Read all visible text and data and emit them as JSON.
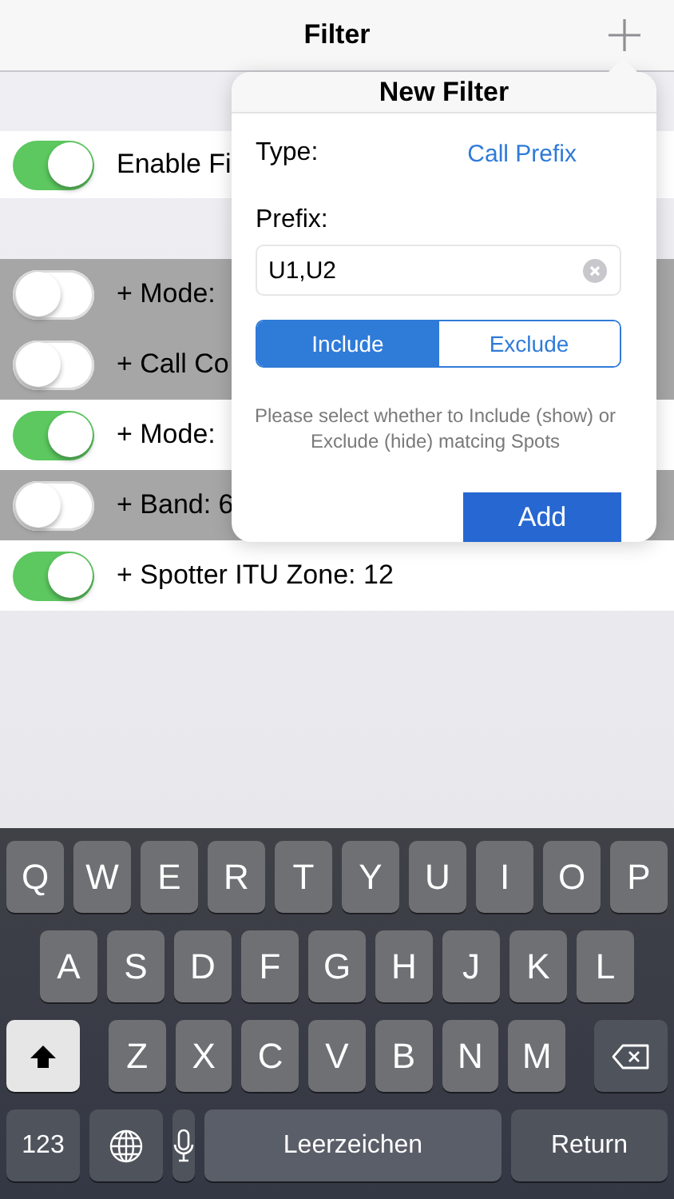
{
  "nav": {
    "title": "Filter"
  },
  "master": {
    "label": "Enable Fi",
    "on": true
  },
  "filters": [
    {
      "label": "+ Mode:",
      "on": false
    },
    {
      "label": "+ Call Co",
      "on": false
    },
    {
      "label": "+ Mode:",
      "on": true
    },
    {
      "label": "+ Band: 6",
      "on": false
    },
    {
      "label": "+ Spotter ITU Zone: 12",
      "on": true
    }
  ],
  "popover": {
    "title": "New Filter",
    "type_label": "Type:",
    "type_value": "Call Prefix",
    "prefix_label": "Prefix:",
    "prefix_value": "U1,U2",
    "segments": [
      {
        "label": "Include",
        "selected": true
      },
      {
        "label": "Exclude",
        "selected": false
      }
    ],
    "hint": "Please select whether to Include (show) or Exclude (hide) matcing Spots",
    "add_button": "Add"
  },
  "keyboard": {
    "rows": [
      {
        "keys": [
          {
            "kind": "letter",
            "label": "Q"
          },
          {
            "kind": "letter",
            "label": "W"
          },
          {
            "kind": "letter",
            "label": "E"
          },
          {
            "kind": "letter",
            "label": "R"
          },
          {
            "kind": "letter",
            "label": "T"
          },
          {
            "kind": "letter",
            "label": "Y"
          },
          {
            "kind": "letter",
            "label": "U"
          },
          {
            "kind": "letter",
            "label": "I"
          },
          {
            "kind": "letter",
            "label": "O"
          },
          {
            "kind": "letter",
            "label": "P"
          }
        ]
      },
      {
        "keys": [
          {
            "kind": "letter",
            "label": "A"
          },
          {
            "kind": "letter",
            "label": "S"
          },
          {
            "kind": "letter",
            "label": "D"
          },
          {
            "kind": "letter",
            "label": "F"
          },
          {
            "kind": "letter",
            "label": "G"
          },
          {
            "kind": "letter",
            "label": "H"
          },
          {
            "kind": "letter",
            "label": "J"
          },
          {
            "kind": "letter",
            "label": "K"
          },
          {
            "kind": "letter",
            "label": "L"
          }
        ]
      },
      {
        "keys": [
          {
            "kind": "shift"
          },
          {
            "kind": "letter",
            "label": "Z"
          },
          {
            "kind": "letter",
            "label": "X"
          },
          {
            "kind": "letter",
            "label": "C"
          },
          {
            "kind": "letter",
            "label": "V"
          },
          {
            "kind": "letter",
            "label": "B"
          },
          {
            "kind": "letter",
            "label": "N"
          },
          {
            "kind": "letter",
            "label": "M"
          },
          {
            "kind": "backspace"
          }
        ]
      },
      {
        "keys": [
          {
            "kind": "numbers",
            "label": "123"
          },
          {
            "kind": "globe"
          },
          {
            "kind": "mic"
          },
          {
            "kind": "space",
            "label": "Leerzeichen"
          },
          {
            "kind": "return",
            "label": "Return"
          }
        ]
      }
    ]
  }
}
